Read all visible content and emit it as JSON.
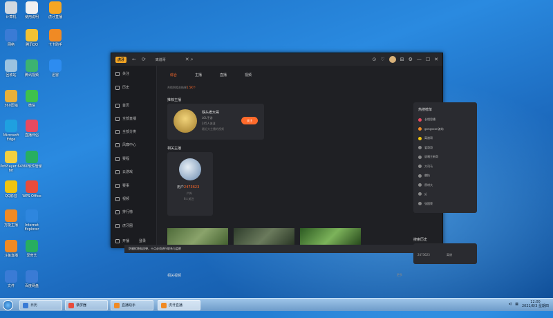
{
  "desktop_icons": [
    {
      "label": "计算机",
      "color": "#d0d8e0"
    },
    {
      "label": "使用说明",
      "color": "#f0f0f0"
    },
    {
      "label": "虎牙直播",
      "color": "#f5a623"
    },
    {
      "label": "网络",
      "color": "#3a7bd5"
    },
    {
      "label": "腾讯QQ",
      "color": "#f2c233"
    },
    {
      "label": "卡卡助手",
      "color": "#f08a24"
    },
    {
      "label": "回收站",
      "color": "#9cc3e0"
    },
    {
      "label": "腾讯视频",
      "color": "#3cb371"
    },
    {
      "label": "迅雷",
      "color": "#2d8cf0"
    },
    {
      "label": "360压缩",
      "color": "#e8b03a"
    },
    {
      "label": "微信",
      "color": "#3ec14b"
    },
    {
      "label": "Microsoft Edge",
      "color": "#1fa0e0"
    },
    {
      "label": "直播伴侣",
      "color": "#e84a5f"
    },
    {
      "label": "PotPlayer 64 bit",
      "color": "#f4d03f"
    },
    {
      "label": "360软件管家",
      "color": "#27ae60"
    },
    {
      "label": "QQ影音",
      "color": "#f1c40f"
    },
    {
      "label": "WPS Office",
      "color": "#e74c3c"
    },
    {
      "label": "万能主播",
      "color": "#f08a24"
    },
    {
      "label": "Internet Explorer",
      "color": "#2e86de"
    },
    {
      "label": "斗鱼直播",
      "color": "#f08a24"
    },
    {
      "label": "爱奇艺",
      "color": "#27ae60"
    },
    {
      "label": "文件",
      "color": "#3a7bd5"
    },
    {
      "label": "百度网盘",
      "color": "#3a7bd5"
    }
  ],
  "app": {
    "logo_text": "虎牙",
    "back_icon": "←",
    "refresh_icon": "⟳",
    "search_query": "离谱哥",
    "close_search": "✕",
    "search_icon": "⌕",
    "window_controls": [
      "⊙",
      "♡",
      "⊞",
      "⚙",
      "—",
      "☐",
      "✕"
    ],
    "sidebar": [
      {
        "label": "关注"
      },
      {
        "label": "历史"
      },
      {
        "label": "首页"
      },
      {
        "label": "全部直播"
      },
      {
        "label": "全部分类"
      },
      {
        "label": "风靡中心"
      },
      {
        "label": "赛程"
      },
      {
        "label": "云游戏"
      },
      {
        "label": "赛事"
      },
      {
        "label": "视频"
      },
      {
        "label": "排行榜"
      },
      {
        "label": "虎牙圈"
      }
    ],
    "sidebar_bottom": {
      "live": "开播",
      "login": "登录"
    },
    "tabs": [
      "综合",
      "主播",
      "直播",
      "视频"
    ],
    "result_text": "共找到相关结果",
    "result_count": "1.5K个",
    "recommended_title": "推荐主播",
    "streamer": {
      "name": "铁头老大哥",
      "category": "LOL手游",
      "followers": "245人关注",
      "intro": "最近大主播的视频",
      "follow_label": "关注"
    },
    "related_title": "相关主播",
    "related": {
      "name": "用户",
      "id": "2473623",
      "sub": "户外",
      "followers": "6人关注"
    },
    "videos_title": "相关视频",
    "more": "更多",
    "hot_title": "热搜榜单",
    "hot_items": [
      {
        "label": "长相思播",
        "color": "#e84a5f"
      },
      {
        "label": "gongsoon渡劫",
        "color": "#f08a24"
      },
      {
        "label": "离谱哥",
        "color": "#f1c40f"
      },
      {
        "label": "爱哥哥",
        "color": "#888888"
      },
      {
        "label": "说唱王新哥",
        "color": "#888888"
      },
      {
        "label": "大司马",
        "color": "#888888"
      },
      {
        "label": "偏执",
        "color": "#888888"
      },
      {
        "label": "原材大",
        "color": "#888888"
      },
      {
        "label": "yj",
        "color": "#888888"
      },
      {
        "label": "张国荣",
        "color": "#888888"
      }
    ],
    "search_history_title": "搜索历史",
    "search_history": [
      "2473623",
      "离谱"
    ]
  },
  "notification": {
    "text": "防骚扰隐私回弹，十点必须进行联系与监察"
  },
  "taskbar": {
    "items": [
      {
        "label": "日历",
        "color": "#3a7bd5",
        "active": false
      },
      {
        "label": "录屏器",
        "color": "#e74c3c",
        "active": false
      },
      {
        "label": "直播助手",
        "color": "#f08a24",
        "active": false
      },
      {
        "label": "虎牙直播",
        "color": "#f08a24",
        "active": true
      }
    ],
    "time": "12:00",
    "date": "2021/6/3 星期四"
  }
}
